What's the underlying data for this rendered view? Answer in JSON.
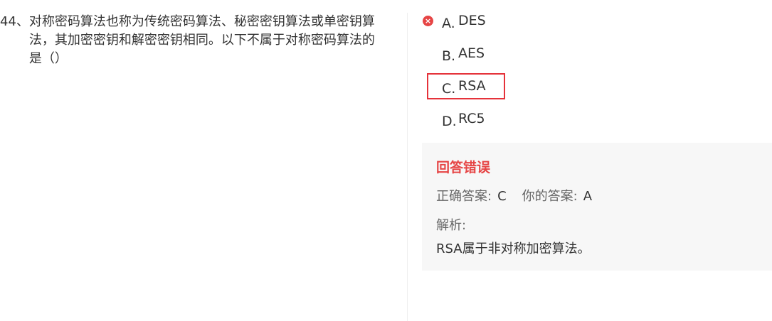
{
  "question": {
    "number": "44、",
    "text": "对称密码算法也称为传统密码算法、秘密密钥算法或单密钥算法，其加密密钥和解密密钥相同。以下不属于对称密码算法的是（）"
  },
  "options": [
    {
      "letter": "A.",
      "text": "DES",
      "wrong_icon": "×"
    },
    {
      "letter": "B.",
      "text": "AES"
    },
    {
      "letter": "C.",
      "text": "RSA"
    },
    {
      "letter": "D.",
      "text": "RC5"
    }
  ],
  "result": {
    "title": "回答错误",
    "correct_label": "正确答案:",
    "correct_value": "C",
    "your_label": "你的答案:",
    "your_value": "A",
    "analysis_label": "解析:",
    "analysis_text": "RSA属于非对称加密算法。"
  },
  "colors": {
    "error_red": "#e64545",
    "highlight_border": "#e5323a",
    "panel_bg": "#f7f7f7"
  },
  "icons": {
    "wrong_marker": "wrong-icon"
  }
}
